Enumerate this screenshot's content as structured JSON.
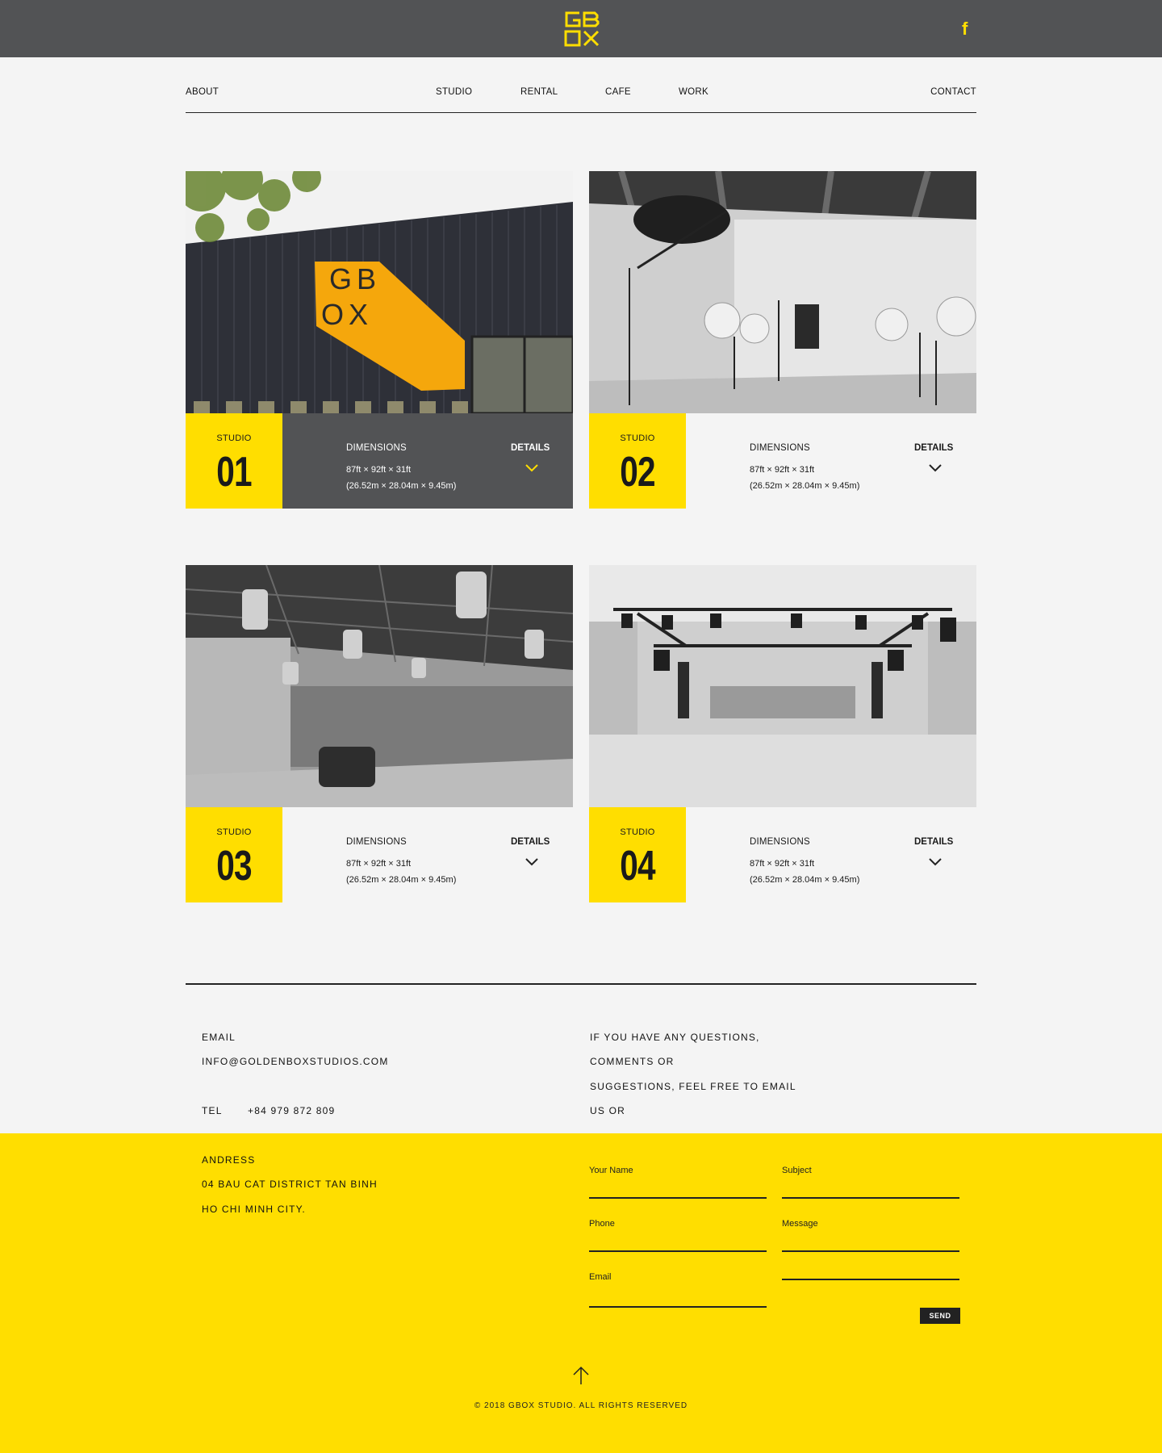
{
  "header": {
    "logo_text": "GBOX",
    "logo_color": "#ffde00",
    "bar_color": "#525355",
    "social_icon": "facebook-icon"
  },
  "nav": {
    "about": "ABOUT",
    "studio": "STUDIO",
    "rental": "RENTAL",
    "cafe": "CAFE",
    "work": "WORK",
    "contact": "CONTACT"
  },
  "studios": [
    {
      "label": "STUDIO",
      "number": "01",
      "dim_label": "DIMENSIONS",
      "dim_imperial": "87ft × 92ft × 31ft",
      "dim_metric": "(26.52m × 28.04m × 9.45m)",
      "details": "DETAILS",
      "active": true,
      "photo": "building exterior with GBOX STUDIO sign"
    },
    {
      "label": "STUDIO",
      "number": "02",
      "dim_label": "DIMENSIONS",
      "dim_imperial": "87ft × 92ft × 31ft",
      "dim_metric": "(26.52m × 28.04m × 9.45m)",
      "details": "DETAILS",
      "active": false,
      "photo": "photo studio with softboxes and umbrellas"
    },
    {
      "label": "STUDIO",
      "number": "03",
      "dim_label": "DIMENSIONS",
      "dim_imperial": "87ft × 92ft × 31ft",
      "dim_metric": "(26.52m × 28.04m × 9.45m)",
      "details": "DETAILS",
      "active": false,
      "photo": "large warehouse studio with car"
    },
    {
      "label": "STUDIO",
      "number": "04",
      "dim_label": "DIMENSIONS",
      "dim_imperial": "87ft × 92ft × 31ft",
      "dim_metric": "(26.52m × 28.04m × 9.45m)",
      "details": "DETAILS",
      "active": false,
      "photo": "hall with lighting rig"
    }
  ],
  "contact": {
    "email_label": "EMAIL",
    "email": "INFO@GOLDENBOXSTUDIOS.COM",
    "tel_label": "TEL",
    "tel": "+84 979 872 809",
    "address_label": "ANDRESS",
    "address_line1": "04 BAU CAT DISTRICT TAN BINH",
    "address_line2": "HO CHI MINH CITY.",
    "blurb_lines": [
      "IF YOU HAVE ANY QUESTIONS,",
      "COMMENTS OR",
      "SUGGESTIONS, FEEL FREE TO EMAIL",
      "US OR"
    ]
  },
  "form": {
    "your_name": "Your Name",
    "subject": "Subject",
    "phone": "Phone",
    "message": "Message",
    "email": "Email",
    "send": "SEND"
  },
  "footer": {
    "copyright": "© 2018 GBOX STUDIO. ALL RIGHTS RESERVED",
    "up_icon": "arrow-up-icon",
    "bg_color": "#ffde00"
  }
}
